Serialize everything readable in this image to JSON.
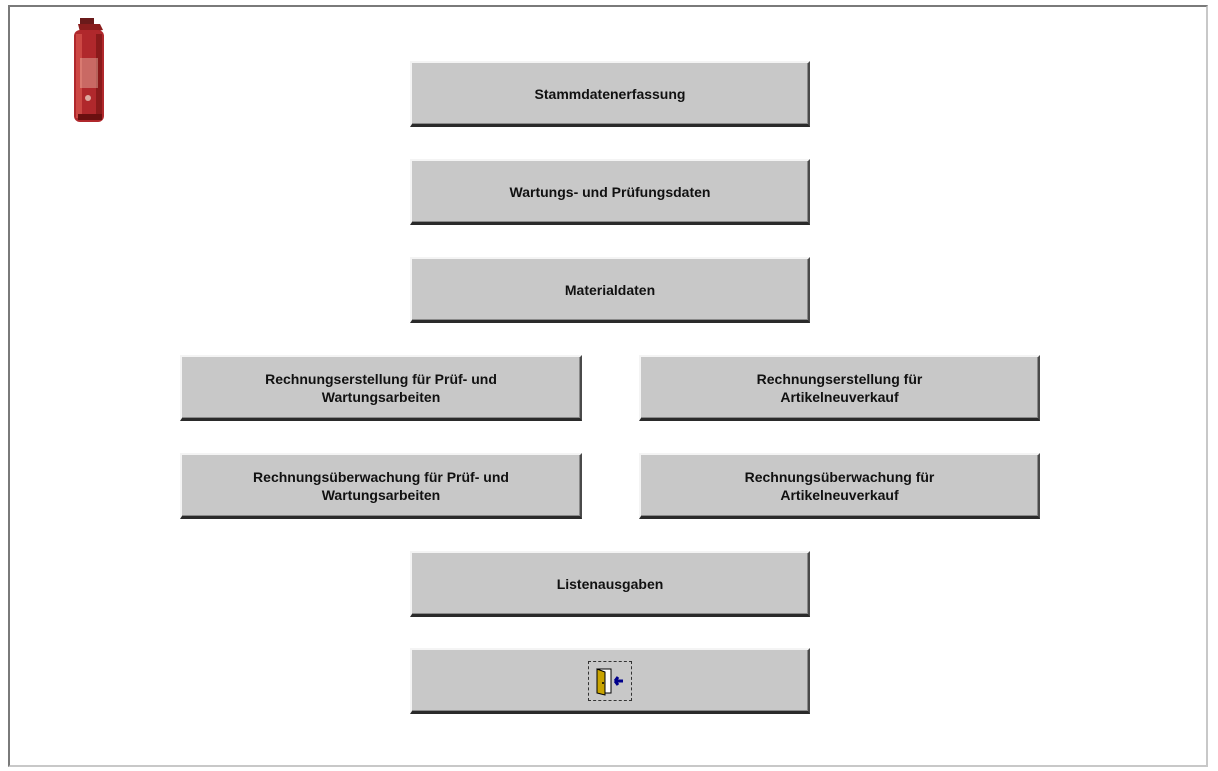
{
  "logo": {
    "icon": "fire-extinguisher-icon"
  },
  "menu": {
    "stammdaten": "Stammdatenerfassung",
    "wartung": "Wartungs- und Prüfungsdaten",
    "material": "Materialdaten",
    "rechnung_pruef": "Rechnungserstellung für Prüf- und\nWartungsarbeiten",
    "rechnung_artikel": "Rechnungserstellung für\nArtikelneuverkauf",
    "ueberwachung_pruef": "Rechnungsüberwachung für Prüf- und\nWartungsarbeiten",
    "ueberwachung_artikel": "Rechnungsüberwachung für\nArtikelneuverkauf",
    "listen": "Listenausgaben",
    "exit_icon": "exit-door-icon"
  },
  "colors": {
    "button_face": "#c8c8c8",
    "extinguisher_red": "#b0282c"
  }
}
